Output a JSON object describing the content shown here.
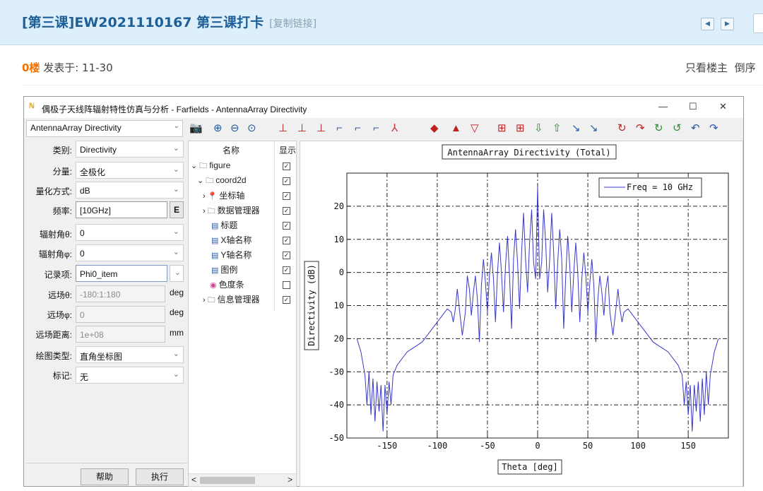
{
  "forum": {
    "title": "[第三课]EW2021110167 第三课打卡",
    "copy_link": "[复制链接]",
    "nav_prev": "◀",
    "nav_next": "▶",
    "floor": "0楼",
    "posted": "发表于: 11-30",
    "only_op": "只看楼主",
    "reverse": "倒序"
  },
  "window": {
    "title": "偶极子天线阵辐射特性仿真与分析 - Farfields - AntennaArray Directivity",
    "min": "—",
    "max": "☐",
    "close": "✕",
    "top_combo": "AntennaArray Directivity",
    "toolbar_icons": [
      "camera-icon",
      "zoom-in-icon",
      "zoom-out-icon",
      "zoom-reset-icon",
      "axis-x-icon",
      "axis-z-icon",
      "axis-y-icon",
      "view-x-icon",
      "view-z-icon",
      "view-y-icon",
      "axes-3d-icon",
      "arrow-up-down-icon",
      "arrow-up-icon",
      "arrow-down-icon",
      "red-grid-icon",
      "red-grid-2-icon",
      "export-down-icon",
      "export-up-icon",
      "rotate-1-icon",
      "rotate-2-icon",
      "rotate-3-icon",
      "rotate-4-icon",
      "rotate-5-icon",
      "rotate-6-icon",
      "rotate-7-icon",
      "rotate-8-icon"
    ]
  },
  "form": {
    "category": {
      "label": "类别:",
      "value": "Directivity"
    },
    "component": {
      "label": "分量:",
      "value": "全极化"
    },
    "quant": {
      "label": "量化方式:",
      "value": "dB"
    },
    "freq": {
      "label": "频率:",
      "value": "[10GHz]",
      "btn": "E"
    },
    "theta": {
      "label": "辐射角θ:",
      "value": "0"
    },
    "phi": {
      "label": "辐射角φ:",
      "value": "0"
    },
    "record": {
      "label": "记录项:",
      "value": "Phi0_item"
    },
    "far_theta": {
      "label": "远场θ:",
      "value": "-180:1:180",
      "unit": "deg"
    },
    "far_phi": {
      "label": "远场φ:",
      "value": "0",
      "unit": "deg"
    },
    "far_dist": {
      "label": "远场距离:",
      "value": "1e+08",
      "unit": "mm"
    },
    "plot_type": {
      "label": "绘图类型:",
      "value": "直角坐标图"
    },
    "marker": {
      "label": "标记:",
      "value": "无"
    },
    "help": "帮助",
    "run": "执行"
  },
  "tree": {
    "col_name": "名称",
    "col_show": "显示",
    "rows": [
      {
        "label": "figure",
        "checked": true
      },
      {
        "label": "coord2d",
        "checked": true
      },
      {
        "label": "坐标轴",
        "checked": true
      },
      {
        "label": "数据管理器",
        "checked": true
      },
      {
        "label": "标题",
        "checked": true
      },
      {
        "label": "X轴名称",
        "checked": true
      },
      {
        "label": "Y轴名称",
        "checked": true
      },
      {
        "label": "图例",
        "checked": true
      },
      {
        "label": "色度条",
        "checked": false
      },
      {
        "label": "信息管理器",
        "checked": true
      }
    ],
    "scroll_left": "<",
    "scroll_right": ">"
  },
  "chart_data": {
    "type": "line",
    "title": "AntennaArray Directivity (Total)",
    "xlabel": "Theta [deg]",
    "ylabel": "Directivity (dB)",
    "xlim": [
      -190,
      190
    ],
    "ylim": [
      -50,
      30
    ],
    "xticks": [
      -150,
      -100,
      -50,
      0,
      50,
      100,
      150
    ],
    "yticks": [
      20,
      10,
      0,
      -10,
      -20,
      -30,
      -40,
      -50
    ],
    "ytick_labels": [
      "20",
      "10",
      "0",
      "10",
      "20",
      "-30",
      "-40",
      "-50"
    ],
    "grid": true,
    "legend_position": "top-right",
    "series": [
      {
        "name": "Freq = 10 GHz",
        "color": "#3838c8",
        "x": [
          -180,
          -176,
          -172,
          -170,
          -168,
          -166,
          -164,
          -162,
          -160,
          -158,
          -156,
          -154,
          -152,
          -150,
          -148,
          -146,
          -144,
          -140,
          -135,
          -130,
          -125,
          -120,
          -115,
          -110,
          -105,
          -100,
          -95,
          -90,
          -86,
          -84,
          -82,
          -80,
          -78,
          -75,
          -72,
          -70,
          -68,
          -66,
          -64,
          -62,
          -60,
          -58,
          -56,
          -54,
          -52,
          -50,
          -48,
          -46,
          -44,
          -42,
          -40,
          -38,
          -36,
          -34,
          -32,
          -30,
          -28,
          -26,
          -24,
          -22,
          -20,
          -18,
          -16,
          -14,
          -12,
          -10,
          -8,
          -6,
          -4,
          -2,
          0,
          2,
          4,
          6,
          8,
          10,
          12,
          14,
          16,
          18,
          20,
          22,
          24,
          26,
          28,
          30,
          32,
          34,
          36,
          38,
          40,
          42,
          44,
          46,
          48,
          50,
          52,
          54,
          56,
          58,
          60,
          62,
          64,
          66,
          68,
          70,
          72,
          75,
          78,
          80,
          82,
          84,
          86,
          90,
          95,
          100,
          105,
          110,
          115,
          120,
          125,
          130,
          135,
          140,
          144,
          146,
          148,
          150,
          152,
          154,
          156,
          158,
          160,
          162,
          164,
          166,
          168,
          170,
          172,
          176,
          180
        ],
        "y": [
          -20,
          -24,
          -31,
          -40,
          -30,
          -43,
          -32,
          -45,
          -33,
          -42,
          -34,
          -48,
          -34,
          -43,
          -33,
          -40,
          -31,
          -28,
          -26,
          -24,
          -23,
          -22,
          -21,
          -19,
          -17,
          -15,
          -13,
          -11,
          -12,
          -15,
          -11,
          -5,
          -11,
          -19,
          -12,
          -1,
          -5,
          -13,
          -6,
          -1,
          -8,
          -21,
          -4,
          4,
          -3,
          -12,
          -1,
          6,
          -2,
          -15,
          0,
          9,
          0,
          -12,
          2,
          11,
          -1,
          -17,
          4,
          13,
          3,
          -11,
          6,
          18,
          4,
          -6,
          9,
          19,
          3,
          -2,
          26,
          -2,
          3,
          19,
          9,
          -6,
          4,
          18,
          6,
          -11,
          3,
          13,
          4,
          -17,
          -1,
          11,
          2,
          -12,
          0,
          9,
          0,
          -15,
          -2,
          6,
          -1,
          -12,
          -3,
          4,
          -4,
          -21,
          -8,
          -1,
          -6,
          -13,
          -5,
          -1,
          -12,
          -19,
          -11,
          -5,
          -11,
          -15,
          -12,
          -11,
          -13,
          -15,
          -17,
          -19,
          -21,
          -22,
          -23,
          -24,
          -26,
          -28,
          -31,
          -40,
          -33,
          -43,
          -34,
          -48,
          -34,
          -42,
          -33,
          -45,
          -32,
          -43,
          -30,
          -40,
          -31,
          -24,
          -20
        ]
      }
    ]
  }
}
